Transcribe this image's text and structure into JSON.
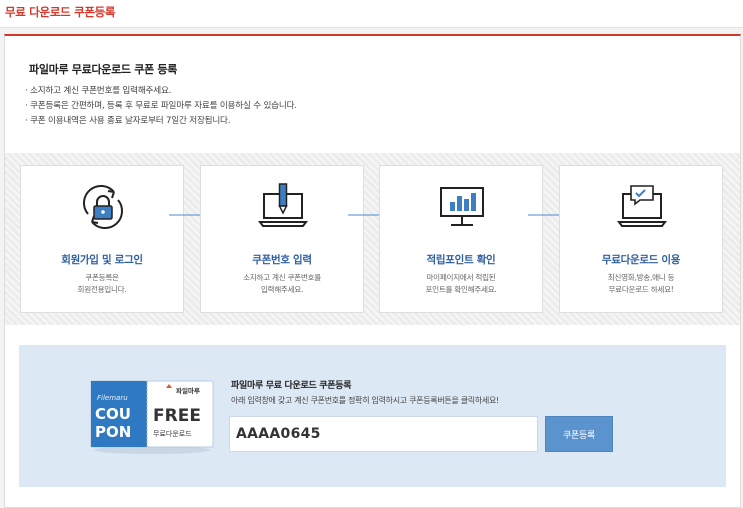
{
  "header": {
    "title": "무료 다운로드 쿠폰등록"
  },
  "intro": {
    "title": "파일마루 무료다운로드 쿠폰 등록",
    "lines": [
      "· 소지하고 계신 쿠폰번호를 입력해주세요.",
      "· 쿠폰등록은 간편하며, 등록 후 무료로 파일마루 자료를 이용하실 수 있습니다.",
      "· 쿠폰 이용내역은 사용 종료 날자로부터 7일간 저장됩니다."
    ]
  },
  "steps": [
    {
      "title": "회원가입 및 로그인",
      "desc": [
        "쿠폰등록은",
        "회원전용입니다."
      ],
      "icon": "lock-refresh-icon"
    },
    {
      "title": "쿠폰번호 입력",
      "desc": [
        "소지하고 계신 쿠폰번호를",
        "입력해주세요."
      ],
      "icon": "laptop-pen-icon"
    },
    {
      "title": "적립포인트 확인",
      "desc": [
        "마이페이지에서 적립된",
        "포인트를 확인해주세요."
      ],
      "icon": "monitor-chart-icon"
    },
    {
      "title": "무료다운로드 이용",
      "desc": [
        "최신영화,방송,애니 등",
        "무료다운로드 하세요!"
      ],
      "icon": "laptop-message-icon"
    }
  ],
  "coupon": {
    "brand": "파일마루",
    "filemaru": "Filemaru",
    "cou": "COU",
    "pon": "PON",
    "free": "FREE",
    "free_sub": "무료다운로드"
  },
  "form": {
    "title": "파일마루 무료 다운로드 쿠폰등록",
    "desc": "아래 입력창에 갖고 계신 쿠폰번호를 정확히 입력하시고 쿠폰등록버튼을 클릭하세요!",
    "code_value": "AAAA0645",
    "button_label": "쿠폰등록"
  },
  "colors": {
    "accent_red": "#d4382b",
    "step_title_blue": "#2f5fa3",
    "coupon_bg": "#dde8f5",
    "button_blue": "#5b93cf"
  }
}
